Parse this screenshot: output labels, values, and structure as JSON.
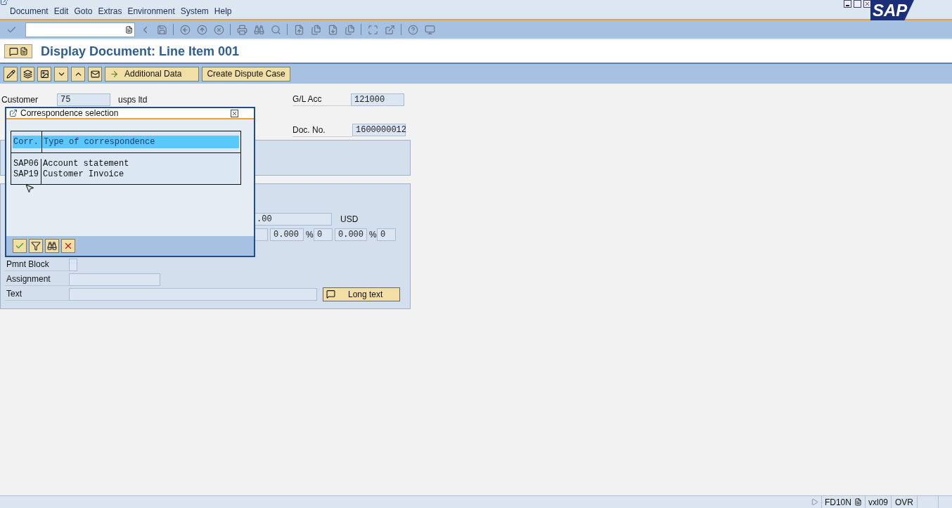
{
  "logo": "SAP",
  "menu": [
    "Document",
    "Edit",
    "Goto",
    "Extras",
    "Environment",
    "System",
    "Help"
  ],
  "title": "Display Document: Line Item 001",
  "app_toolbar": [
    {
      "label": "Additional Data"
    },
    {
      "label": "Create Dispute Case"
    }
  ],
  "header": {
    "customer_label": "Customer",
    "customer_value": "75",
    "customer_name": "usps ltd",
    "gl_label": "G/L Acc",
    "gl_value": "121000",
    "doc_label": "Doc. No.",
    "doc_value": "1600000012"
  },
  "amounts": {
    "amount": ".00",
    "currency": "USD",
    "discount_1": "0.000",
    "percent_1": "%",
    "days_1": "0",
    "discount_2": "0.000",
    "percent_2": "%",
    "days_2": "0"
  },
  "fields": [
    {
      "label": "Pmnt Block",
      "kind": "check",
      "checked": false
    },
    {
      "label": "Assignment",
      "kind": "short"
    },
    {
      "label": "Text",
      "kind": "long"
    }
  ],
  "long_text_button": "Long text",
  "dialog": {
    "title": "Correspondence selection",
    "columns": [
      "Corr.",
      "Type of correspondence"
    ],
    "rows": [
      {
        "code": "SAP06",
        "type": "Account statement"
      },
      {
        "code": "SAP19",
        "type": "Customer Invoice"
      }
    ]
  },
  "status_bar": {
    "transaction": "FD10N",
    "server": "vxl09",
    "mode": "OVR"
  }
}
